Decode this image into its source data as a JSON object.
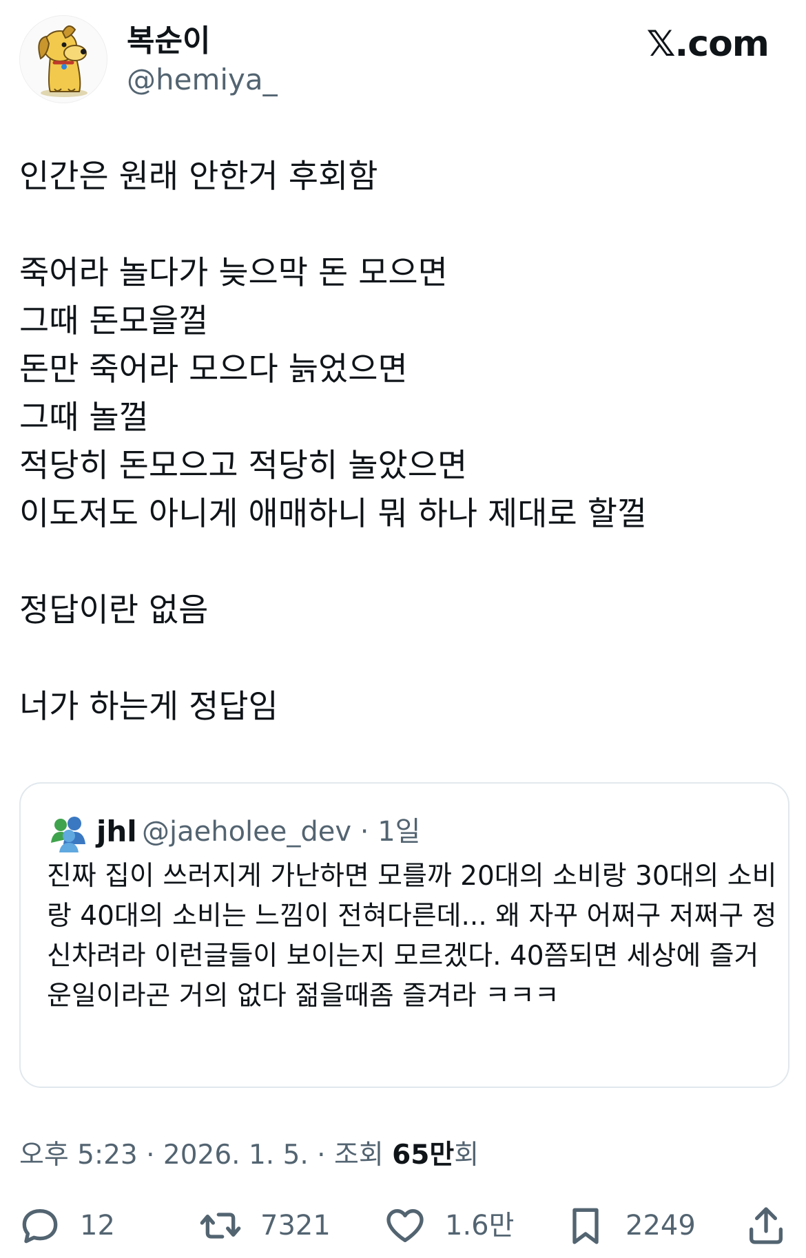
{
  "author": {
    "display_name": "복순이",
    "handle": "@hemiya_"
  },
  "brand": "𝕏.com",
  "tweet": {
    "lines": [
      "인간은 원래 안한거 후회함",
      "",
      "죽어라 놀다가 늦으막 돈 모으면",
      "그때 돈모을껄",
      "돈만 죽어라 모으다 늙었으면",
      "그때 놀껄",
      "적당히 돈모으고 적당히 놀았으면",
      "이도저도 아니게 애매하니 뭐 하나 제대로 할껄",
      "",
      "정답이란 없음",
      "",
      "너가 하는게 정답임"
    ]
  },
  "quote": {
    "name": "jhl",
    "handle_time": "@jaeholee_dev · 1일",
    "text": "진짜 집이 쓰러지게 가난하면 모를까 20대의 소비랑 30대의 소비랑 40대의 소비는 느낌이 전혀다른데... 왜 자꾸 어쩌구 저쩌구 정신차려라 이런글들이 보이는지 모르겠다. 40쯤되면 세상에 즐거운일이라곤 거의 없다 젊을때좀 즐겨라 ㅋㅋㅋ"
  },
  "meta": {
    "time_date": "오후 5:23 · 2026. 1. 5. · 조회 ",
    "views": "65만",
    "views_suffix": "회"
  },
  "actions": {
    "replies": "12",
    "retweets": "7321",
    "likes": "1.6만",
    "bookmarks": "2249"
  },
  "icons": {
    "reply": "speech-bubble-icon",
    "retweet": "retweet-arrows-icon",
    "like": "heart-icon",
    "bookmark": "bookmark-icon",
    "share": "share-upload-icon"
  },
  "colors": {
    "text": "#0f1419",
    "secondary": "#536471",
    "border": "#e1e8ed"
  }
}
